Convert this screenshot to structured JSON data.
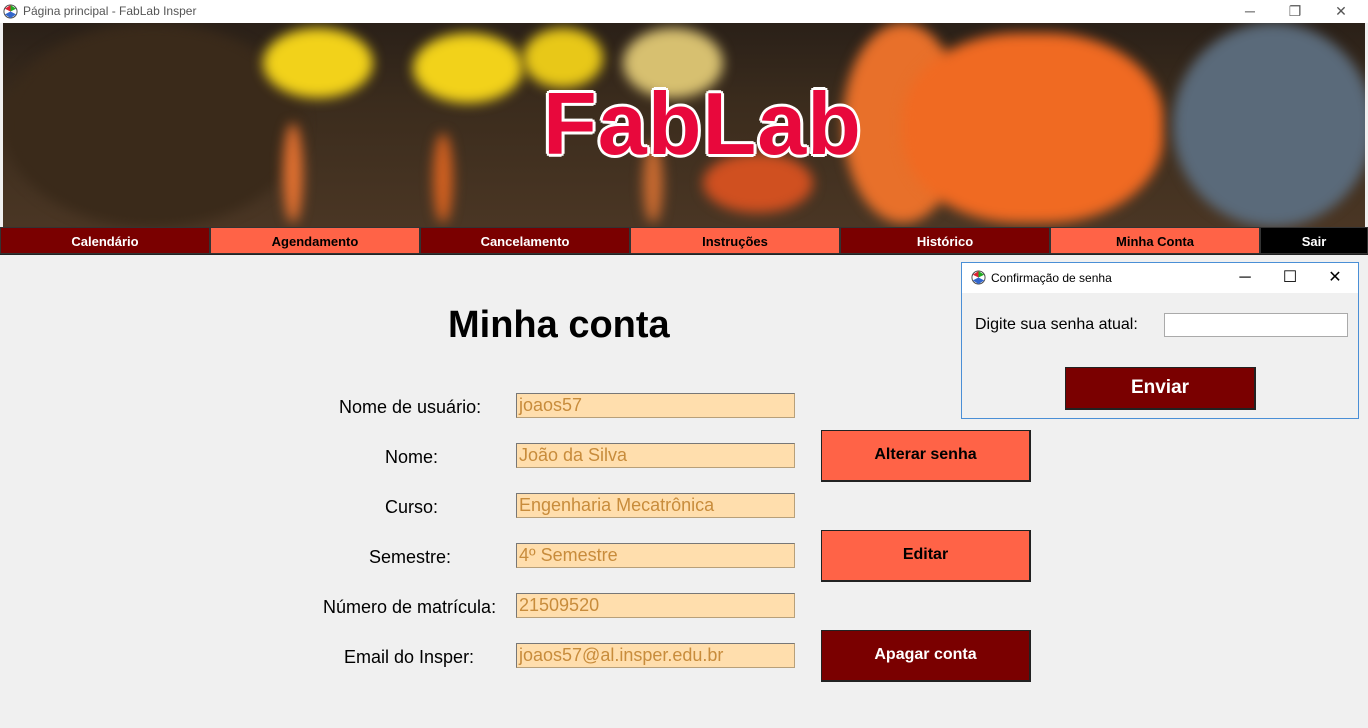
{
  "window": {
    "title": "Página principal - FabLab Insper",
    "minimize": "─",
    "restore": "❐",
    "close": "✕"
  },
  "banner": {
    "logo": "FabLab"
  },
  "nav": {
    "items": [
      "Calendário",
      "Agendamento",
      "Cancelamento",
      "Instruções",
      "Histórico",
      "Minha Conta",
      "Sair"
    ]
  },
  "account": {
    "heading": "Minha conta",
    "labels": {
      "username": "Nome de usuário:",
      "name": "Nome:",
      "course": "Curso:",
      "semester": "Semestre:",
      "enrollment": "Número de matrícula:",
      "email": "Email do Insper:"
    },
    "values": {
      "username": "joaos57",
      "name": "João da Silva",
      "course": "Engenharia Mecatrônica",
      "semester": "4º Semestre",
      "enrollment": "21509520",
      "email": "joaos57@al.insper.edu.br"
    },
    "buttons": {
      "change_password": "Alterar senha",
      "edit": "Editar",
      "delete": "Apagar conta"
    }
  },
  "dialog": {
    "title": "Confirmação de senha",
    "minimize": "─",
    "maximize": "☐",
    "close": "✕",
    "prompt": "Digite sua senha atual:",
    "password_value": "",
    "submit": "Enviar"
  },
  "colors": {
    "nav_dark": "#7a0000",
    "nav_light": "#ff6347",
    "field_bg": "#ffdead",
    "field_text": "#c88c3c",
    "logo_red": "#e8083c"
  }
}
